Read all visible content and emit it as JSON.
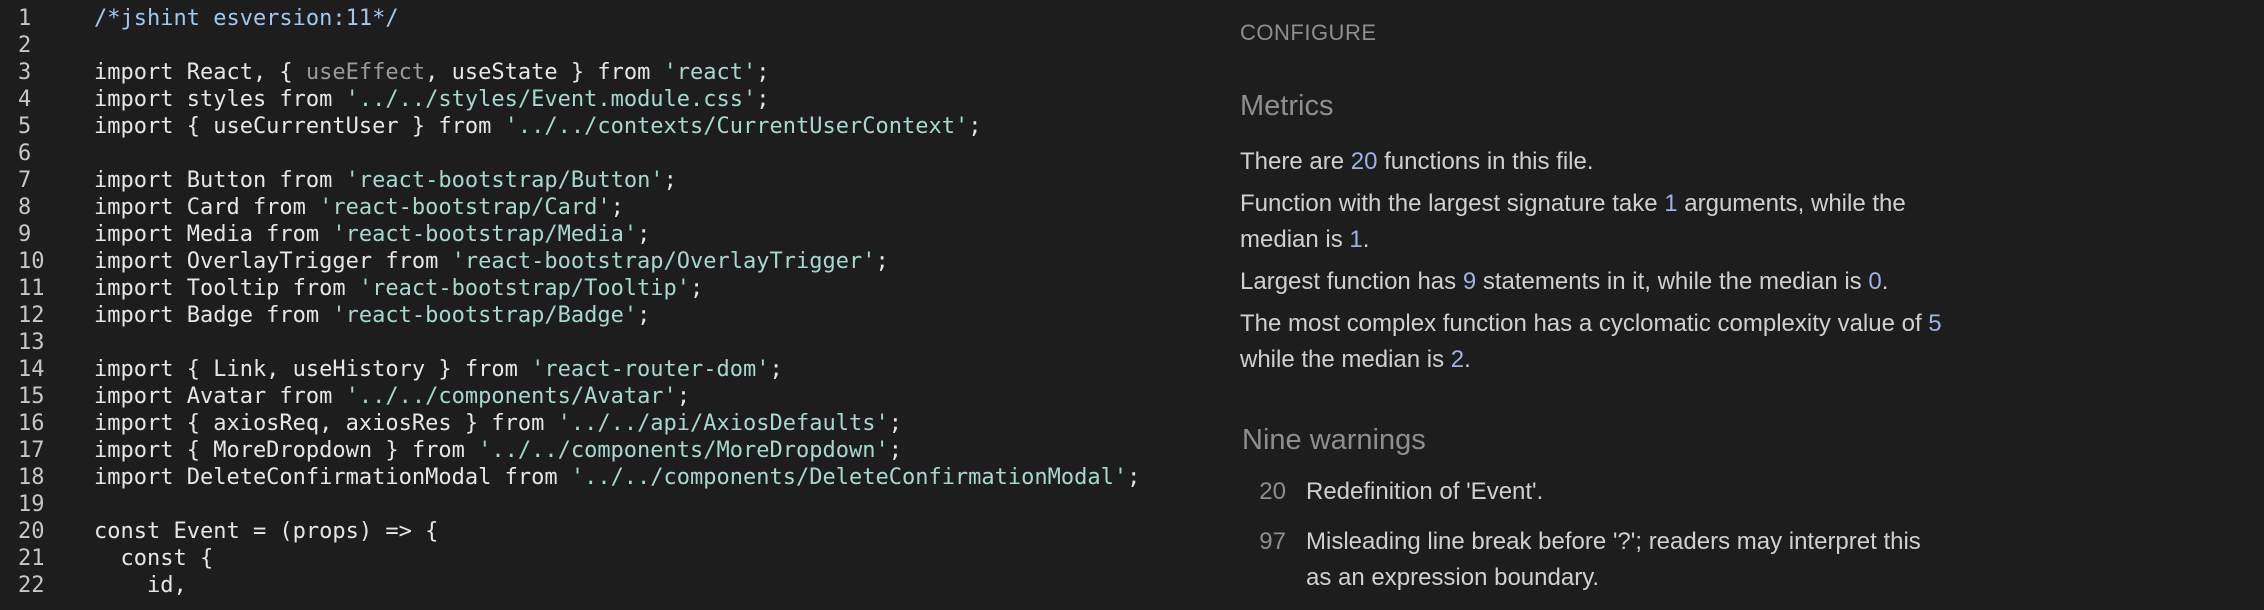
{
  "editor": {
    "lines": [
      {
        "n": "1",
        "segs": [
          {
            "t": "/*jshint esversion:11*/",
            "c": "cmt"
          }
        ]
      },
      {
        "n": "2",
        "segs": []
      },
      {
        "n": "3",
        "segs": [
          {
            "t": "import React, { ",
            "c": ""
          },
          {
            "t": "useEffect",
            "c": "muted"
          },
          {
            "t": ", useState } from ",
            "c": ""
          },
          {
            "t": "'react'",
            "c": "str"
          },
          {
            "t": ";",
            "c": ""
          }
        ]
      },
      {
        "n": "4",
        "segs": [
          {
            "t": "import styles from ",
            "c": ""
          },
          {
            "t": "'../../styles/Event.module.css'",
            "c": "str"
          },
          {
            "t": ";",
            "c": ""
          }
        ]
      },
      {
        "n": "5",
        "segs": [
          {
            "t": "import { useCurrentUser } from ",
            "c": ""
          },
          {
            "t": "'../../contexts/CurrentUserContext'",
            "c": "str"
          },
          {
            "t": ";",
            "c": ""
          }
        ]
      },
      {
        "n": "6",
        "segs": []
      },
      {
        "n": "7",
        "segs": [
          {
            "t": "import Button from ",
            "c": ""
          },
          {
            "t": "'react-bootstrap/Button'",
            "c": "str"
          },
          {
            "t": ";",
            "c": ""
          }
        ]
      },
      {
        "n": "8",
        "segs": [
          {
            "t": "import Card from ",
            "c": ""
          },
          {
            "t": "'react-bootstrap/Card'",
            "c": "str"
          },
          {
            "t": ";",
            "c": ""
          }
        ]
      },
      {
        "n": "9",
        "segs": [
          {
            "t": "import Media from ",
            "c": ""
          },
          {
            "t": "'react-bootstrap/Media'",
            "c": "str"
          },
          {
            "t": ";",
            "c": ""
          }
        ]
      },
      {
        "n": "10",
        "segs": [
          {
            "t": "import OverlayTrigger from ",
            "c": ""
          },
          {
            "t": "'react-bootstrap/OverlayTrigger'",
            "c": "str"
          },
          {
            "t": ";",
            "c": ""
          }
        ]
      },
      {
        "n": "11",
        "segs": [
          {
            "t": "import Tooltip from ",
            "c": ""
          },
          {
            "t": "'react-bootstrap/Tooltip'",
            "c": "str"
          },
          {
            "t": ";",
            "c": ""
          }
        ]
      },
      {
        "n": "12",
        "segs": [
          {
            "t": "import Badge from ",
            "c": ""
          },
          {
            "t": "'react-bootstrap/Badge'",
            "c": "str"
          },
          {
            "t": ";",
            "c": ""
          }
        ]
      },
      {
        "n": "13",
        "segs": []
      },
      {
        "n": "14",
        "segs": [
          {
            "t": "import { Link, useHistory } from ",
            "c": ""
          },
          {
            "t": "'react-router-dom'",
            "c": "str"
          },
          {
            "t": ";",
            "c": ""
          }
        ]
      },
      {
        "n": "15",
        "segs": [
          {
            "t": "import Avatar from ",
            "c": ""
          },
          {
            "t": "'../../components/Avatar'",
            "c": "str"
          },
          {
            "t": ";",
            "c": ""
          }
        ]
      },
      {
        "n": "16",
        "segs": [
          {
            "t": "import { axiosReq, axiosRes } from ",
            "c": ""
          },
          {
            "t": "'../../api/AxiosDefaults'",
            "c": "str"
          },
          {
            "t": ";",
            "c": ""
          }
        ]
      },
      {
        "n": "17",
        "segs": [
          {
            "t": "import { MoreDropdown } from ",
            "c": ""
          },
          {
            "t": "'../../components/MoreDropdown'",
            "c": "str"
          },
          {
            "t": ";",
            "c": ""
          }
        ]
      },
      {
        "n": "18",
        "segs": [
          {
            "t": "import DeleteConfirmationModal from ",
            "c": ""
          },
          {
            "t": "'../../components/DeleteConfirmationModal'",
            "c": "str"
          },
          {
            "t": ";",
            "c": ""
          }
        ]
      },
      {
        "n": "19",
        "segs": []
      },
      {
        "n": "20",
        "segs": [
          {
            "t": "const Event = (props) => {",
            "c": ""
          }
        ]
      },
      {
        "n": "21",
        "segs": [
          {
            "t": "  const {",
            "c": ""
          }
        ]
      },
      {
        "n": "22",
        "segs": [
          {
            "t": "    id,",
            "c": ""
          }
        ]
      }
    ]
  },
  "panel": {
    "configure_label": "CONFIGURE",
    "metrics_heading": "Metrics",
    "metrics": [
      [
        {
          "t": "There are "
        },
        {
          "t": "20",
          "num": true
        },
        {
          "t": " functions in this file."
        }
      ],
      [
        {
          "t": "Function with the largest signature take "
        },
        {
          "t": "1",
          "num": true
        },
        {
          "t": " arguments, while the median is "
        },
        {
          "t": "1",
          "num": true
        },
        {
          "t": "."
        }
      ],
      [
        {
          "t": "Largest function has "
        },
        {
          "t": "9",
          "num": true
        },
        {
          "t": " statements in it, while the median is "
        },
        {
          "t": "0",
          "num": true
        },
        {
          "t": "."
        }
      ],
      [
        {
          "t": "The most complex function has a cyclomatic complexity value of "
        },
        {
          "t": "5",
          "num": true
        },
        {
          "t": " while the median is "
        },
        {
          "t": "2",
          "num": true
        },
        {
          "t": "."
        }
      ]
    ],
    "warnings_heading": "Nine warnings",
    "warnings": [
      {
        "line": "20",
        "text": "Redefinition of 'Event'."
      },
      {
        "line": "97",
        "text": "Misleading line break before '?'; readers may interpret this as an expression boundary."
      }
    ]
  }
}
